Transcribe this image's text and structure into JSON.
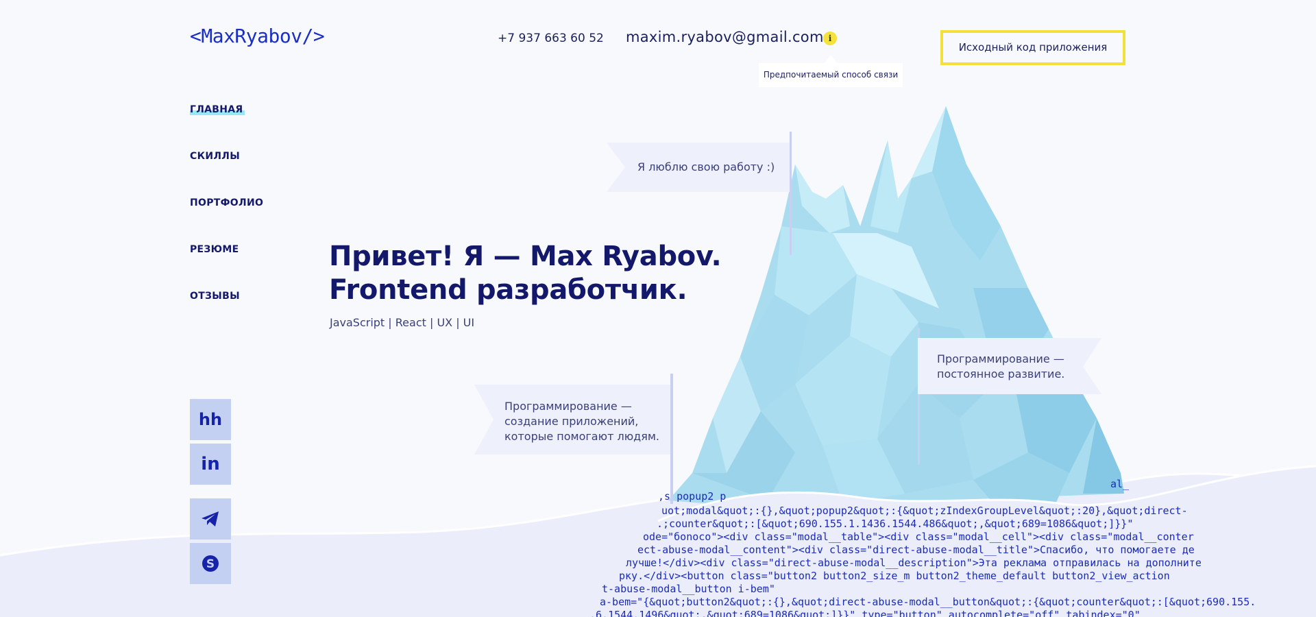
{
  "header": {
    "logo": "<MaxRyabov/>",
    "phone": "+7 937 663 60 52",
    "email": "maxim.ryabov@gmail.com",
    "info_icon": "info-icon",
    "tooltip": "Предпочитаемый способ связи",
    "source_button": "Исходный код приложения"
  },
  "nav": {
    "items": [
      {
        "label": "ГЛАВНАЯ",
        "active": true
      },
      {
        "label": "СКИЛЛЫ"
      },
      {
        "label": "ПОРТФОЛИО"
      },
      {
        "label": "РЕЗЮМЕ"
      },
      {
        "label": "ОТЗЫВЫ"
      }
    ]
  },
  "hero": {
    "title_line1": "Привет! Я — Max Ryabov.",
    "title_line2": "Frontend разработчик.",
    "subtitle": "JavaScript | React | UX | UI"
  },
  "flags": {
    "flag1": "Я люблю свою работу :)",
    "flag2_line1": "Программирование —",
    "flag2_line2": "постоянное развитие.",
    "flag3_line1": "Программирование —",
    "flag3_line2": "создание приложений,",
    "flag3_line3": "которые помогают людям."
  },
  "social": [
    {
      "name": "hh",
      "label": "hh"
    },
    {
      "name": "linkedin",
      "label": "in"
    },
    {
      "name": "telegram",
      "label": ""
    },
    {
      "name": "skype",
      "label": ""
    }
  ],
  "code_overlay": [
    ",s popup2 p",
    "uot;modal&quot;:{},&quot;popup2&quot;:{&quot;zIndexGroupLevel&quot;:20},&quot;direct-",
    ".;counter&quot;:[&quot;690.155.1.1436.1544.486&quot;,&quot;689=1086&quot;]}}\"",
    "ode=\"бonoco\"><div class=\"modal__table\"><div class=\"modal__cell\"><div class=\"modal__conter",
    "ect-abuse-modal__content\"><div class=\"direct-abuse-modal__title\">Спасибо, что помогаете де",
    "лучше!</div><div class=\"direct-abuse-modal__description\">Эта реклама отправилась на дополните",
    "рку.</div><button class=\"button2 button2_size_m button2_theme_default button2_view_action",
    "t-abuse-modal__button i-bem\"",
    "a-bem=\"{&quot;button2&quot;:{},&quot;direct-abuse-modal__button&quot;:{&quot;counter&quot;:[&quot;690.155.",
    ".6.1544.1496&quot;,&quot;689=1086&quot;]}}\" type=\"button\" autocomplete=\"off\" tabindex=\"0\"",
    "al_"
  ]
}
